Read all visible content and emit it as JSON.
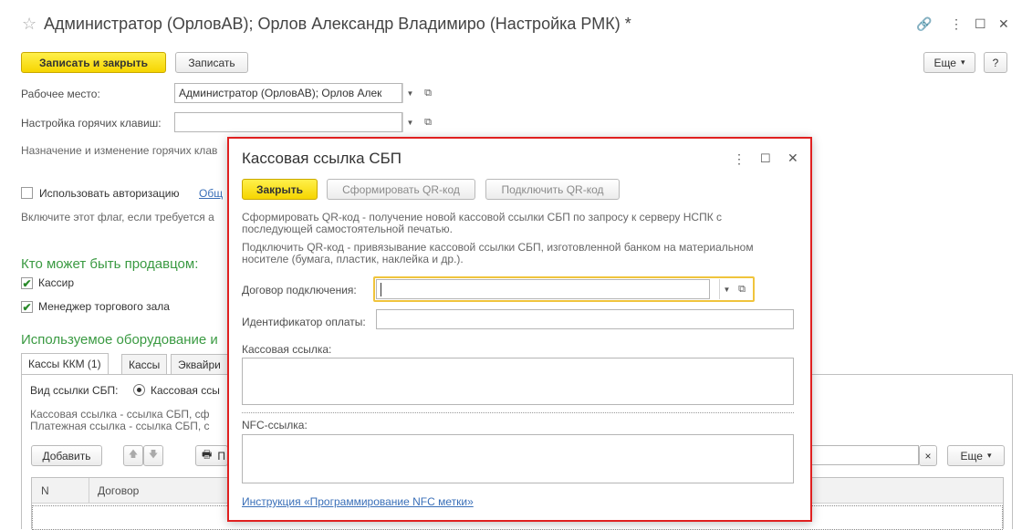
{
  "window": {
    "title": "Администратор (ОрловАВ); Орлов Александр Владимиро (Настройка РМК) *",
    "star_icon": "☆",
    "link_icon": "🔗",
    "menu_icon": "⋮",
    "maximize_icon": "☐",
    "close_icon": "✕"
  },
  "toolbar": {
    "save_close": "Записать и закрыть",
    "save": "Записать",
    "more": "Еще",
    "more_arrow": "▾",
    "help": "?"
  },
  "form": {
    "workplace_label": "Рабочее место:",
    "workplace_value": "Администратор (ОрловАВ); Орлов Алек",
    "hotkeys_label": "Настройка горячих клавиш:",
    "hotkeys_value": "",
    "hotkeys_hint": "Назначение и изменение горячих клав",
    "use_auth_label": "Использовать авторизацию",
    "use_auth_link": "Общ",
    "use_auth_checked": false,
    "auth_hint": "Включите этот флаг, если требуется а",
    "seller_title": "Кто может быть продавцом:",
    "cashier_label": "Кассир",
    "cashier_checked": true,
    "manager_label": "Менеджер торгового зала",
    "manager_checked": true,
    "equipment_title": "Используемое оборудование и"
  },
  "tabs": [
    "Кассы ККМ (1)",
    "Кассы",
    "Эквайри"
  ],
  "tab_content": {
    "sbp_type_label": "Вид ссылки СБП:",
    "sbp_type_option": "Кассовая ссы",
    "hint_line1": "Кассовая ссылка - ссылка СБП, сф",
    "hint_line2": "Платежная ссылка - ссылка СБП, с",
    "add_button": "Добавить",
    "up_icon": "🡅",
    "down_icon": "🡇",
    "print_icon": "🖶",
    "print_label": "П",
    "clear_icon": "×",
    "more": "Еще",
    "more_arrow": "▾",
    "columns": [
      "N",
      "Договор"
    ]
  },
  "dialog": {
    "title": "Кассовая ссылка СБП",
    "menu_icon": "⋮",
    "maximize_icon": "☐",
    "close_icon": "✕",
    "close_button": "Закрыть",
    "generate_qr": "Сформировать QR-код",
    "connect_qr": "Подключить QR-код",
    "hint_line1": "Сформировать QR-код - получение новой кассовой ссылки СБП по запросу к серверу НСПК с",
    "hint_line2": "последующей самостоятельной печатью.",
    "hint_line3": "Подключить QR-код - привязывание кассовой ссылки СБП, изготовленной банком на материальном",
    "hint_line4": "носителе (бумага, пластик, наклейка и др.).",
    "contract_label": "Договор подключения:",
    "contract_value": "",
    "payment_id_label": "Идентификатор оплаты:",
    "payment_id_value": "",
    "cash_link_label": "Кассовая ссылка:",
    "nfc_label": "NFC-ссылка:",
    "instruction_link": "Инструкция «Программирование NFC метки»"
  },
  "colors": {
    "accent_yellow": "#f6d500",
    "section_green": "#3a9a42",
    "dialog_border": "#e02020",
    "link_blue": "#3a6fb8"
  }
}
